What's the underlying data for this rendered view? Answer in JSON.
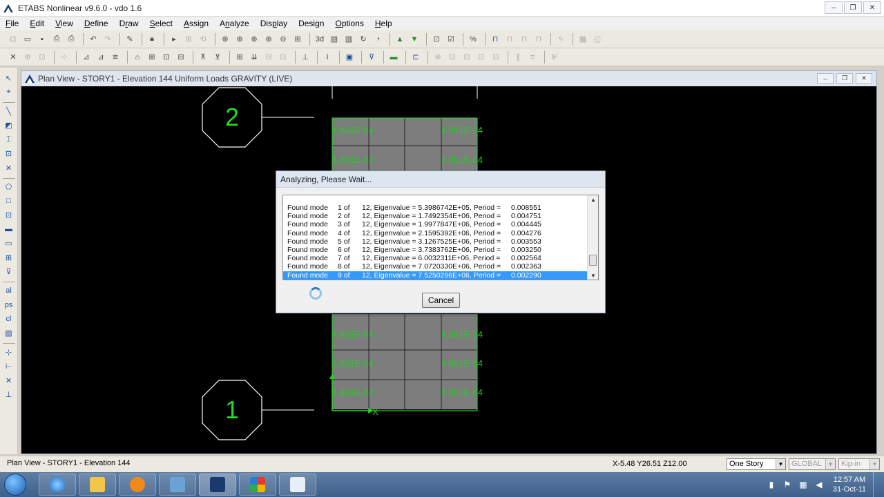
{
  "window": {
    "title": "ETABS Nonlinear v9.6.0 - vdo 1.6",
    "minimize": "–",
    "maximize": "❐",
    "close": "✕"
  },
  "menu": [
    {
      "label": "File",
      "key": "F",
      "rest": "ile"
    },
    {
      "label": "Edit",
      "key": "E",
      "rest": "dit"
    },
    {
      "label": "View",
      "key": "V",
      "rest": "iew"
    },
    {
      "label": "Define",
      "key": "D",
      "rest": "efine"
    },
    {
      "label": "Draw",
      "key": "r",
      "pre": "D",
      "rest": "aw"
    },
    {
      "label": "Select",
      "key": "S",
      "rest": "elect"
    },
    {
      "label": "Assign",
      "key": "A",
      "rest": "ssign"
    },
    {
      "label": "Analyze",
      "key": "n",
      "pre": "A",
      "rest": "alyze"
    },
    {
      "label": "Display",
      "key": "p",
      "pre": "Dis",
      "rest": "lay"
    },
    {
      "label": "Design",
      "key": "g",
      "pre": "Desi",
      "rest": "n"
    },
    {
      "label": "Options",
      "key": "O",
      "rest": "ptions"
    },
    {
      "label": "Help",
      "key": "H",
      "rest": "elp"
    }
  ],
  "plan_window": {
    "title": "Plan View - STORY1 - Elevation 144  Uniform Loads GRAVITY  (LIVE)"
  },
  "canvas": {
    "grid_bubbles": [
      "2",
      "1"
    ],
    "load_value": "4.861E-04",
    "axis_label": "X"
  },
  "dialog": {
    "title": "Analyzing, Please Wait...",
    "rows": [
      {
        "label": "Found mode",
        "mode": "1 of",
        "eig": "12, Eigenvalue = 5.3986742E+05, Period =",
        "period": "0.008551"
      },
      {
        "label": "Found mode",
        "mode": "2 of",
        "eig": "12, Eigenvalue = 1.7492354E+06, Period =",
        "period": "0.004751"
      },
      {
        "label": "Found mode",
        "mode": "3 of",
        "eig": "12, Eigenvalue = 1.9977847E+06, Period =",
        "period": "0.004445"
      },
      {
        "label": "Found mode",
        "mode": "4 of",
        "eig": "12, Eigenvalue = 2.1595392E+06, Period =",
        "period": "0.004276"
      },
      {
        "label": "Found mode",
        "mode": "5 of",
        "eig": "12, Eigenvalue = 3.1267525E+06, Period =",
        "period": "0.003553"
      },
      {
        "label": "Found mode",
        "mode": "6 of",
        "eig": "12, Eigenvalue = 3.7383762E+06, Period =",
        "period": "0.003250"
      },
      {
        "label": "Found mode",
        "mode": "7 of",
        "eig": "12, Eigenvalue = 6.0032311E+06, Period =",
        "period": "0.002564"
      },
      {
        "label": "Found mode",
        "mode": "8 of",
        "eig": "12, Eigenvalue = 7.0720330E+06, Period =",
        "period": "0.002363"
      },
      {
        "label": "Found mode",
        "mode": "9 of",
        "eig": "12, Eigenvalue = 7.5250296E+06, Period =",
        "period": "0.002290"
      }
    ],
    "cancel_label": "Cancel"
  },
  "statusbar": {
    "left": "Plan View - STORY1 - Elevation 144",
    "coords": "X-5.48  Y26.51  Z12.00",
    "story_select": "One Story",
    "coord_system": "GLOBAL",
    "units": "Kip-in"
  },
  "taskbar": {
    "time": "12:57 AM",
    "date": "31-Oct-11"
  }
}
